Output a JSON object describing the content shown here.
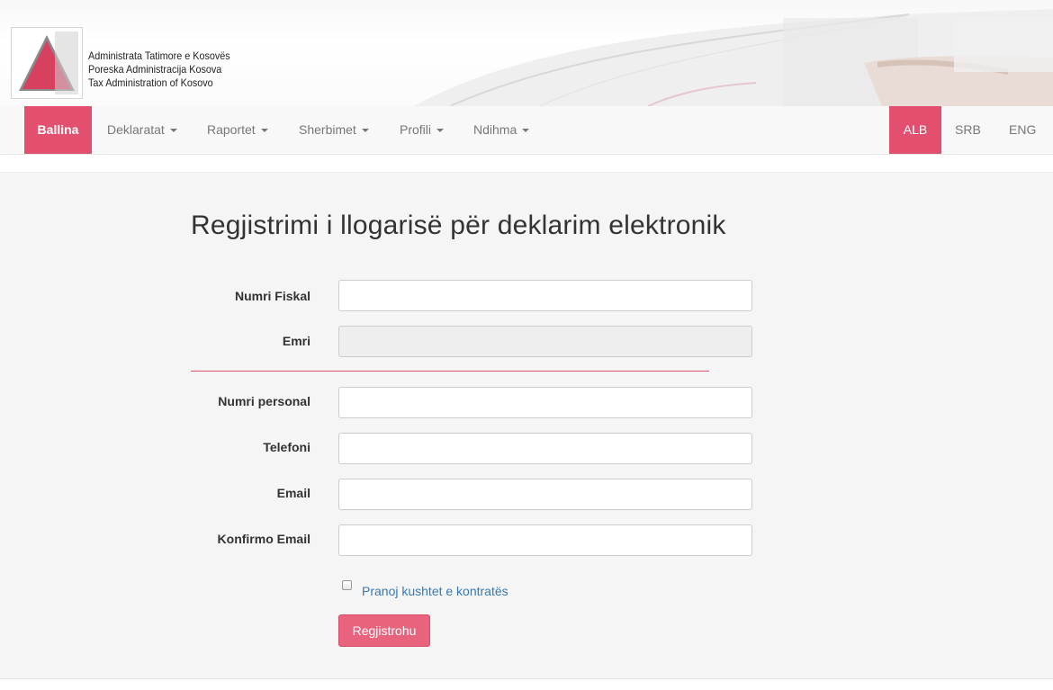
{
  "header": {
    "org_names": [
      "Administrata Tatimore e Kosovës",
      "Poreska Administracija Kosova",
      "Tax Administration of Kosovo"
    ],
    "logo_color": "#d8405f"
  },
  "nav": {
    "items": [
      {
        "label": "Ballina",
        "active": true
      },
      {
        "label": "Deklaratat"
      },
      {
        "label": "Raportet"
      },
      {
        "label": "Sherbimet"
      },
      {
        "label": "Profili"
      },
      {
        "label": "Ndihma"
      }
    ],
    "languages": [
      {
        "label": "ALB",
        "active": true
      },
      {
        "label": "SRB"
      },
      {
        "label": "ENG"
      }
    ]
  },
  "form": {
    "title": "Regjistrimi i llogarisë për deklarim elektronik",
    "fields": {
      "numri_fiskal": {
        "label": "Numri Fiskal",
        "value": ""
      },
      "emri": {
        "label": "Emri",
        "value": ""
      },
      "numri_personal": {
        "label": "Numri personal",
        "value": ""
      },
      "telefoni": {
        "label": "Telefoni",
        "value": ""
      },
      "email": {
        "label": "Email",
        "value": ""
      },
      "konfirmo_email": {
        "label": "Konfirmo Email",
        "value": ""
      }
    },
    "terms_label": "Pranoj kushtet e kontratës",
    "submit_label": "Regjistrohu"
  },
  "colors": {
    "accent": "#e34f6f",
    "link": "#337ab7",
    "content_bg": "#f5f5f5"
  }
}
